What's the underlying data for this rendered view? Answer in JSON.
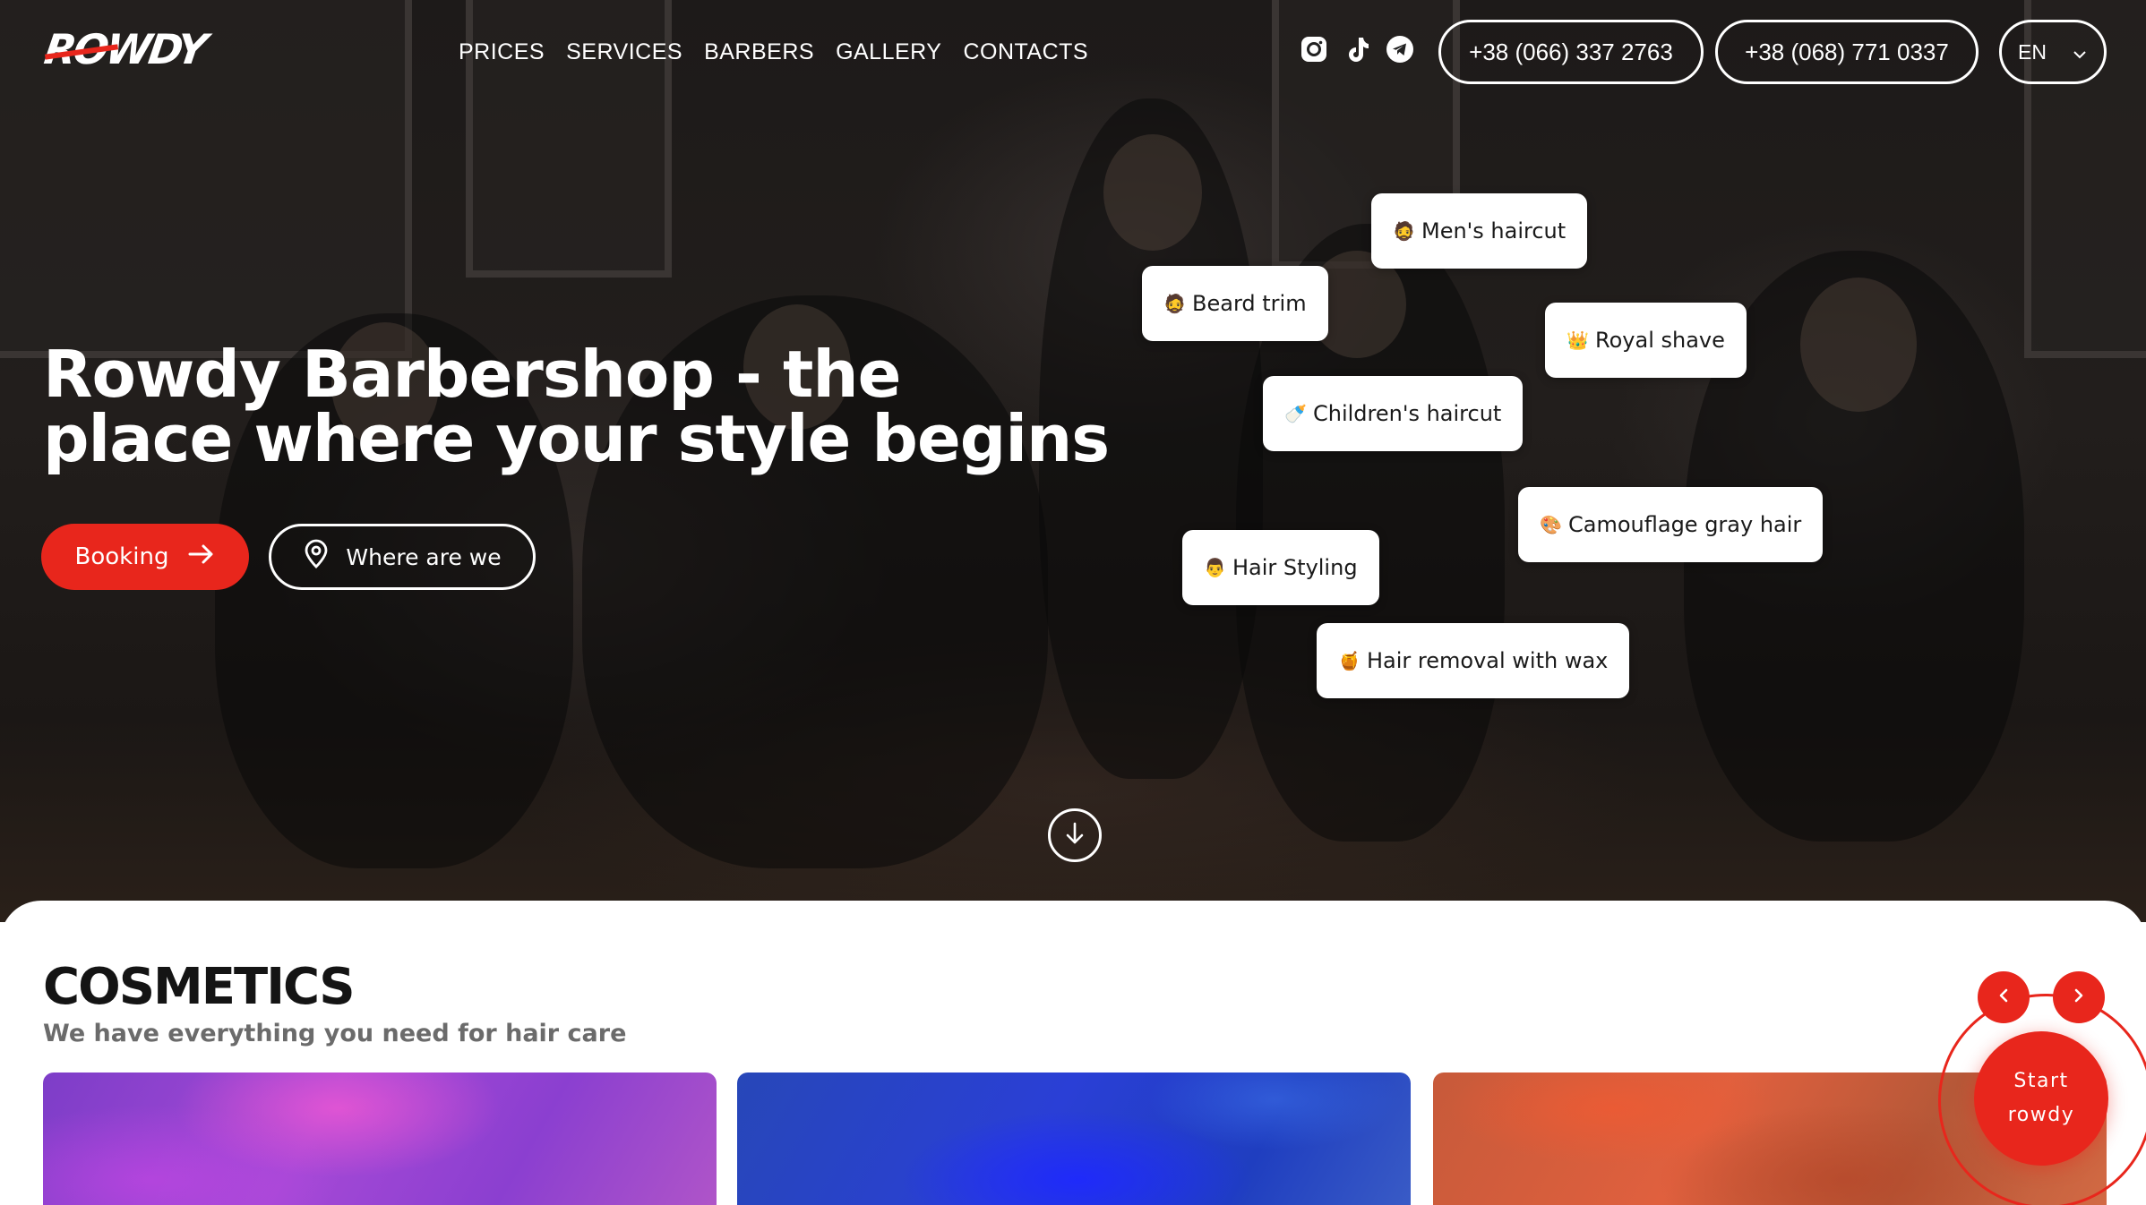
{
  "brand": {
    "logo_text": "ROWDY",
    "accent": "#e8261c"
  },
  "nav": {
    "items": [
      "PRICES",
      "SERVICES",
      "BARBERS",
      "GALLERY",
      "CONTACTS"
    ]
  },
  "social": [
    "instagram-icon",
    "tiktok-icon",
    "telegram-icon"
  ],
  "phones": [
    "+38 (066) 337 2763",
    "+38 (068) 771 0337"
  ],
  "language": {
    "selected": "EN"
  },
  "hero": {
    "title_line1": "Rowdy Barbershop - the",
    "title_line2": "place where your style begins",
    "booking_label": "Booking",
    "where_label": "Where are we"
  },
  "service_tags": [
    {
      "emoji": "🧔",
      "label": "Men's haircut"
    },
    {
      "emoji": "🧔",
      "label": "Beard trim"
    },
    {
      "emoji": "👑",
      "label": "Royal shave"
    },
    {
      "emoji": "🍼",
      "label": "Children's haircut"
    },
    {
      "emoji": "🎨",
      "label": "Camouflage gray hair"
    },
    {
      "emoji": "👨",
      "label": "Hair Styling"
    },
    {
      "emoji": "🍯",
      "label": "Hair removal with wax"
    }
  ],
  "cosmetics": {
    "title": "COSMETICS",
    "subtitle": "We have everything you need for hair care",
    "prev_label": "‹",
    "next_label": "›"
  },
  "start_button": {
    "line1": "Start",
    "line2": "rowdy"
  }
}
